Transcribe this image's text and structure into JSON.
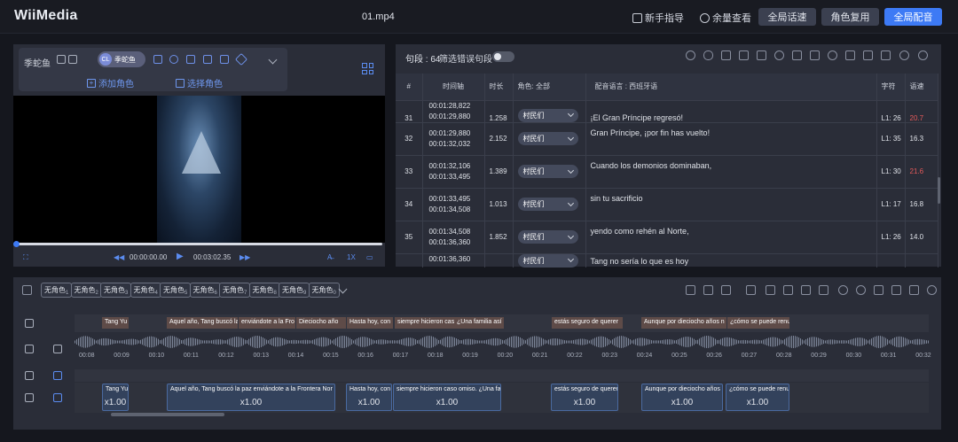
{
  "header": {
    "logo": "WiiMedia",
    "filename": "01.mp4",
    "guide": "新手指导",
    "balance": "余量查看",
    "btn_global_voice": "全局话速",
    "btn_role_reuse": "角色复用",
    "btn_global_dub": "全局配音"
  },
  "role_panel": {
    "name": "季蛇鱼",
    "chip_avatar": "CL",
    "chip_name": "季蛇鱼",
    "add_role": "添加角色",
    "select_role": "选择角色"
  },
  "player": {
    "time_current": "00:00:00.00",
    "time_total": "00:03:02.35",
    "speed": "1X"
  },
  "table": {
    "segments_label": "句段 : 64",
    "filter_label": "筛选错误句段",
    "headers": {
      "num": "#",
      "timeline": "时间轴",
      "duration": "时长",
      "role": "角色:",
      "role_all": "全部",
      "dub_lang": "配音语言 : 西班牙语",
      "chars": "字符",
      "speed": "语速"
    },
    "rows": [
      {
        "num": "31",
        "start": "00:01:28,822",
        "end": "00:01:29,880",
        "duration": "1.258",
        "role": "村民们",
        "text": "¡El Gran Príncipe regresó!",
        "chars": "L1: 26",
        "speed": "20.7",
        "speed_warn": true
      },
      {
        "num": "32",
        "start": "00:01:29,880",
        "end": "00:01:32,032",
        "duration": "2.152",
        "role": "村民们",
        "text": "Gran Príncipe, ¡por fin has vuelto!",
        "chars": "L1: 35",
        "speed": "16.3",
        "speed_warn": false
      },
      {
        "num": "33",
        "start": "00:01:32,106",
        "end": "00:01:33,495",
        "duration": "1.389",
        "role": "村民们",
        "text": "Cuando los demonios dominaban,",
        "chars": "L1: 30",
        "speed": "21.6",
        "speed_warn": true
      },
      {
        "num": "34",
        "start": "00:01:33,495",
        "end": "00:01:34,508",
        "duration": "1.013",
        "role": "村民们",
        "text": "sin tu sacrificio",
        "chars": "L1: 17",
        "speed": "16.8",
        "speed_warn": false
      },
      {
        "num": "35",
        "start": "00:01:34,508",
        "end": "00:01:36,360",
        "duration": "1.852",
        "role": "村民们",
        "text": "yendo como rehén al Norte,",
        "chars": "L1: 26",
        "speed": "14.0",
        "speed_warn": false
      },
      {
        "num": "",
        "start": "00:01:36,360",
        "end": "",
        "duration": "",
        "role": "村民们",
        "text": "Tang no sería lo que es hoy",
        "chars": "",
        "speed": "",
        "speed_warn": false
      }
    ]
  },
  "timeline": {
    "role_tabs": [
      {
        "label": "无角色",
        "n": "1"
      },
      {
        "label": "无角色",
        "n": "2"
      },
      {
        "label": "无角色",
        "n": "3"
      },
      {
        "label": "无角色",
        "n": "4"
      },
      {
        "label": "无角色",
        "n": "5"
      },
      {
        "label": "无角色",
        "n": "6"
      },
      {
        "label": "无角色",
        "n": "7"
      },
      {
        "label": "无角色",
        "n": "8"
      },
      {
        "label": "无角色",
        "n": "9"
      },
      {
        "label": "无角色",
        "n": "0"
      }
    ],
    "ticks": [
      "00:08",
      "00:09",
      "00:10",
      "00:11",
      "00:12",
      "00:13",
      "00:14",
      "00:15",
      "00:16",
      "00:17",
      "00:18",
      "00:19",
      "00:20",
      "00:21",
      "00:22",
      "00:23",
      "00:24",
      "00:25",
      "00:26",
      "00:27",
      "00:28",
      "00:29",
      "00:30",
      "00:31",
      "00:32"
    ],
    "subtitles": [
      "Tang Yu",
      "Aquel año, Tang buscó la",
      "enviándote a la Fro",
      "Dieciocho año",
      "Hasta hoy, con",
      "siempre hicieron cas",
      "¿Una familia así",
      "estás seguro de querer",
      "Aunque por dieciocho años n",
      "¿cómo se puede renu"
    ],
    "segments": [
      {
        "text": "Tang Yu",
        "speed": "x1.00"
      },
      {
        "text": "Aquel año, Tang buscó la paz enviándote a la Frontera Nor",
        "speed": "x1.00"
      },
      {
        "text": "Hasta hoy, con",
        "speed": "x1.00"
      },
      {
        "text": "siempre hicieron caso omiso. ¿Una fa",
        "speed": "x1.00"
      },
      {
        "text": "estás seguro de querer",
        "speed": "x1.00"
      },
      {
        "text": "Aunque por dieciocho años n",
        "speed": "x1.00"
      },
      {
        "text": "¿cómo se puede renu",
        "speed": "x1.00"
      }
    ]
  }
}
